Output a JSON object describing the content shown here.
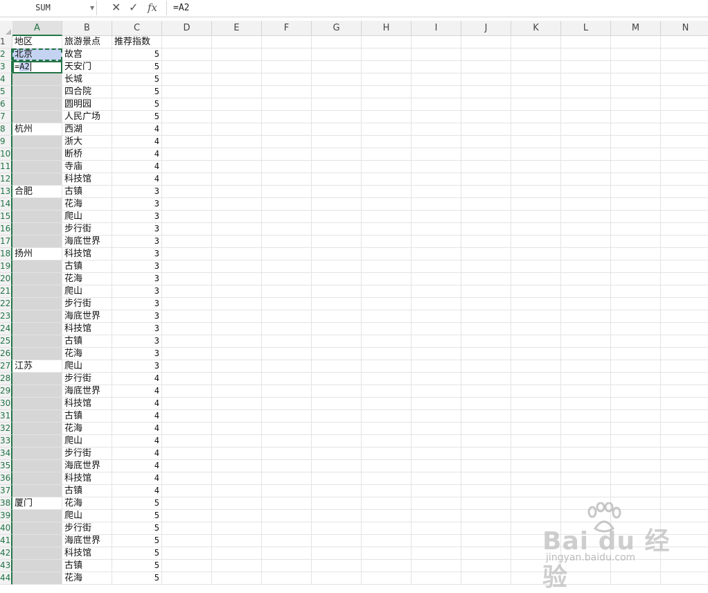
{
  "formula_bar": {
    "name_box": "SUM",
    "cancel_icon": "✕",
    "enter_icon": "✓",
    "fx_label": "fx",
    "formula": "=A2"
  },
  "columns": [
    "A",
    "B",
    "C",
    "D",
    "E",
    "F",
    "G",
    "H",
    "I",
    "J",
    "K",
    "L",
    "M",
    "N"
  ],
  "selected_column": "A",
  "editing_cell": {
    "row": 3,
    "prefix": "=",
    "ref": "A2"
  },
  "copy_source_cell": {
    "row": 2
  },
  "rows": [
    {
      "n": "1",
      "a": "地区",
      "b": "旅游景点",
      "c": "推荐指数"
    },
    {
      "n": "2",
      "a": "北京",
      "b": "故宫",
      "c": "5"
    },
    {
      "n": "3",
      "a": "",
      "b": "天安门",
      "c": "5"
    },
    {
      "n": "4",
      "a": "",
      "b": "长城",
      "c": "5"
    },
    {
      "n": "5",
      "a": "",
      "b": "四合院",
      "c": "5"
    },
    {
      "n": "6",
      "a": "",
      "b": "圆明园",
      "c": "5"
    },
    {
      "n": "7",
      "a": "",
      "b": "人民广场",
      "c": "5"
    },
    {
      "n": "8",
      "a": "杭州",
      "b": "西湖",
      "c": "4"
    },
    {
      "n": "9",
      "a": "",
      "b": "浙大",
      "c": "4"
    },
    {
      "n": "10",
      "a": "",
      "b": "断桥",
      "c": "4"
    },
    {
      "n": "11",
      "a": "",
      "b": "寺庙",
      "c": "4"
    },
    {
      "n": "12",
      "a": "",
      "b": "科技馆",
      "c": "4"
    },
    {
      "n": "13",
      "a": "合肥",
      "b": "古镇",
      "c": "3"
    },
    {
      "n": "14",
      "a": "",
      "b": "花海",
      "c": "3"
    },
    {
      "n": "15",
      "a": "",
      "b": "爬山",
      "c": "3"
    },
    {
      "n": "16",
      "a": "",
      "b": "步行街",
      "c": "3"
    },
    {
      "n": "17",
      "a": "",
      "b": "海底世界",
      "c": "3"
    },
    {
      "n": "18",
      "a": "扬州",
      "b": "科技馆",
      "c": "3"
    },
    {
      "n": "19",
      "a": "",
      "b": "古镇",
      "c": "3"
    },
    {
      "n": "20",
      "a": "",
      "b": "花海",
      "c": "3"
    },
    {
      "n": "21",
      "a": "",
      "b": "爬山",
      "c": "3"
    },
    {
      "n": "22",
      "a": "",
      "b": "步行街",
      "c": "3"
    },
    {
      "n": "23",
      "a": "",
      "b": "海底世界",
      "c": "3"
    },
    {
      "n": "24",
      "a": "",
      "b": "科技馆",
      "c": "3"
    },
    {
      "n": "25",
      "a": "",
      "b": "古镇",
      "c": "3"
    },
    {
      "n": "26",
      "a": "",
      "b": "花海",
      "c": "3"
    },
    {
      "n": "27",
      "a": "江苏",
      "b": "爬山",
      "c": "3"
    },
    {
      "n": "28",
      "a": "",
      "b": "步行街",
      "c": "4"
    },
    {
      "n": "29",
      "a": "",
      "b": "海底世界",
      "c": "4"
    },
    {
      "n": "30",
      "a": "",
      "b": "科技馆",
      "c": "4"
    },
    {
      "n": "31",
      "a": "",
      "b": "古镇",
      "c": "4"
    },
    {
      "n": "32",
      "a": "",
      "b": "花海",
      "c": "4"
    },
    {
      "n": "33",
      "a": "",
      "b": "爬山",
      "c": "4"
    },
    {
      "n": "34",
      "a": "",
      "b": "步行街",
      "c": "4"
    },
    {
      "n": "35",
      "a": "",
      "b": "海底世界",
      "c": "4"
    },
    {
      "n": "36",
      "a": "",
      "b": "科技馆",
      "c": "4"
    },
    {
      "n": "37",
      "a": "",
      "b": "古镇",
      "c": "4"
    },
    {
      "n": "38",
      "a": "厦门",
      "b": "花海",
      "c": "5"
    },
    {
      "n": "39",
      "a": "",
      "b": "爬山",
      "c": "5"
    },
    {
      "n": "40",
      "a": "",
      "b": "步行街",
      "c": "5"
    },
    {
      "n": "41",
      "a": "",
      "b": "海底世界",
      "c": "5"
    },
    {
      "n": "42",
      "a": "",
      "b": "科技馆",
      "c": "5"
    },
    {
      "n": "43",
      "a": "",
      "b": "古镇",
      "c": "5"
    },
    {
      "n": "44",
      "a": "",
      "b": "花海",
      "c": "5"
    }
  ],
  "watermark": {
    "brand": "Bai du 经验",
    "url": "jingyan.baidu.com"
  },
  "colors": {
    "accent": "#217346",
    "selection_fill": "#d6d6d6",
    "copy_fill": "#c5d3f2"
  }
}
